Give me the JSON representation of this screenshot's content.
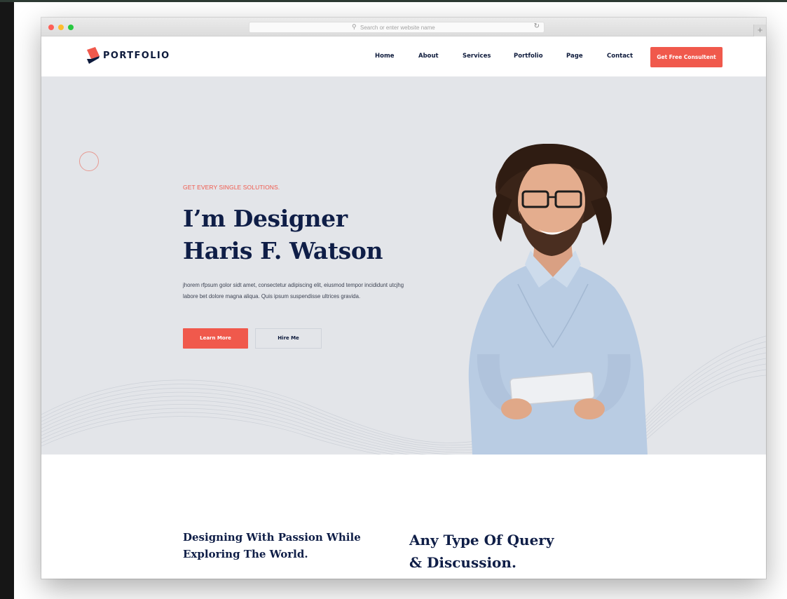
{
  "browser": {
    "url_placeholder": "Search or enter website name"
  },
  "nav": {
    "logo_text": "PORTFOLIO",
    "links": [
      "Home",
      "About",
      "Services",
      "Portfolio",
      "Page",
      "Contact"
    ],
    "cta_label": "Get Free Consultent"
  },
  "hero": {
    "eyebrow": "GET EVERY SINGLE SOLUTIONS.",
    "title_line1": "I’m Designer",
    "title_line2": "Haris F. Watson",
    "description": "jhorem rfpsum golor sidt amet, consectetur adipiscing elit, eiusmod tempor incididunt utcjhg labore bet dolore magna aliqua. Quis ipsum suspendisse ultrices gravida.",
    "primary_button": "Learn More",
    "secondary_button": "Hire Me"
  },
  "section2": {
    "left_line1": "Designing With Passion While",
    "left_line2": "Exploring The World.",
    "right_line1": "Any Type Of Query",
    "right_line2": "& Discussion."
  },
  "colors": {
    "accent": "#f0594c",
    "heading": "#0f1e47",
    "hero_bg": "#e3e5e9"
  },
  "icons": [
    "search-icon",
    "reload-icon",
    "new-tab-icon",
    "logo-icon"
  ]
}
